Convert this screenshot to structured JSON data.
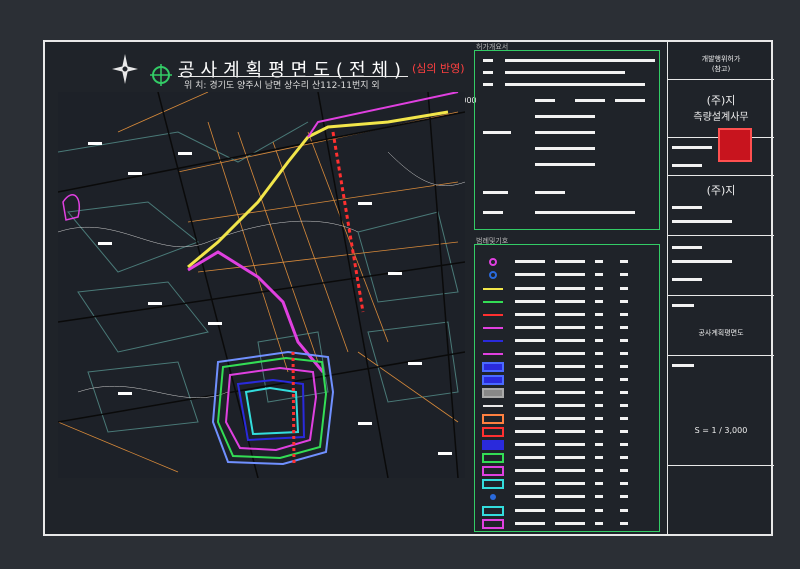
{
  "header": {
    "title": "공사계획평면도(전체)",
    "review_note": "(심의 반영)",
    "location": "위  치: 경기도  양주시  남면  상수리  산112-11번지  외  "
  },
  "map": {
    "scale": "S = 1 / 3,000"
  },
  "panels": {
    "summary_heading": "허가개요서",
    "legend_heading": "범례및기호"
  },
  "title_block": {
    "permit_label": "개발행위허가",
    "reference_label": "(참고)",
    "company_line1": "(주)지",
    "company_line2": "측량설계사무",
    "company_line3": "(주)지",
    "drawing_name": "공사계획평면도",
    "scale": "S = 1 / 3,000"
  },
  "colors": {
    "background": "#2b2f35",
    "sheet": "#1f2329",
    "border": "#e8e8e8",
    "accent_green": "#33cc66",
    "review_red": "#ff4040",
    "stamp_red": "#c8141e"
  },
  "icons": {
    "compass": "north-arrow-icon",
    "target": "crosshair-icon"
  }
}
